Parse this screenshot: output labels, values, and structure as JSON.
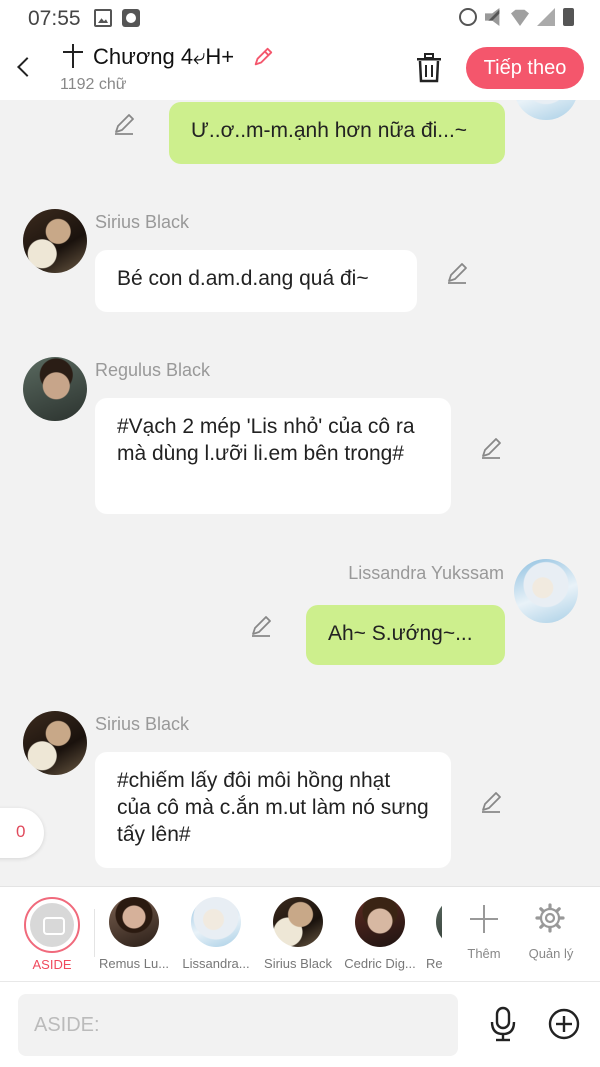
{
  "status_bar": {
    "time": "07:55"
  },
  "header": {
    "title": "Chương 4⤶H+",
    "word_count": "1192 chữ",
    "next_label": "Tiếp theo"
  },
  "messages": [
    {
      "side": "out",
      "sender": "",
      "text": "Ư..ơ..m-m.ạnh hơn nữa đi...~"
    },
    {
      "side": "in",
      "sender": "Sirius Black",
      "text": "Bé con d.am.d.ang quá đi~"
    },
    {
      "side": "in",
      "sender": "Regulus Black",
      "text": "#Vạch 2 mép 'Lis nhỏ' của cô ra mà dùng l.ưỡi li.em bên trong#"
    },
    {
      "side": "out",
      "sender": "Lissandra Yukssam",
      "text": "Ah~ S.ướng~..."
    },
    {
      "side": "in",
      "sender": "Sirius Black",
      "text": "#chiếm lấy đôi môi hồng nhạt của cô mà c.ắn m.ut làm nó sưng tấy lên#"
    }
  ],
  "floating_badge": "0",
  "character_bar": {
    "aside_label": "ASIDE",
    "characters": [
      "Remus Lu...",
      "Lissandra...",
      "Sirius Black",
      "Cedric Dig...",
      "Re"
    ],
    "add_label": "Thêm",
    "manage_label": "Quản lý"
  },
  "input": {
    "placeholder": "ASIDE:",
    "value": ""
  },
  "colors": {
    "accent": "#f4566c",
    "outgoing_bubble": "#cdef8d",
    "incoming_bubble": "#ffffff",
    "background": "#f2f2f2"
  },
  "icons": [
    "back-arrow-icon",
    "cross-icon",
    "pencil-icon",
    "trash-icon",
    "plus-icon",
    "gear-icon",
    "microphone-icon",
    "plus-circle-icon"
  ]
}
